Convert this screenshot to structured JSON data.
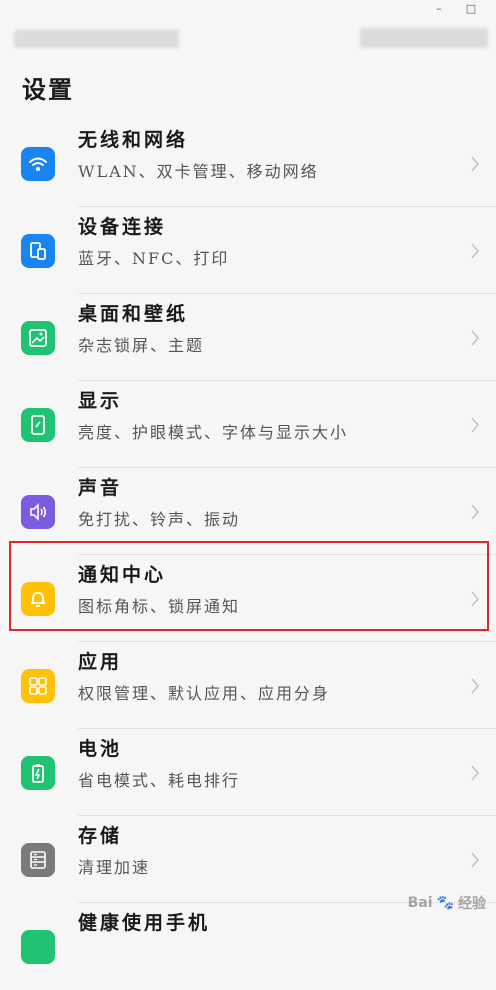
{
  "window_controls": {
    "minimize": "–",
    "maximize": "□"
  },
  "page_title": "设置",
  "settings_items": [
    {
      "label": "无线和网络",
      "sub": "WLAN、双卡管理、移动网络",
      "icon": "wifi-icon",
      "color": "#1a84f0"
    },
    {
      "label": "设备连接",
      "sub": "蓝牙、NFC、打印",
      "icon": "device-connect-icon",
      "color": "#1a84f0"
    },
    {
      "label": "桌面和壁纸",
      "sub": "杂志锁屏、主题",
      "icon": "wallpaper-icon",
      "color": "#1fc372"
    },
    {
      "label": "显示",
      "sub": "亮度、护眼模式、字体与显示大小",
      "icon": "display-icon",
      "color": "#1fc372"
    },
    {
      "label": "声音",
      "sub": "免打扰、铃声、振动",
      "icon": "sound-icon",
      "color": "#7b5be0"
    },
    {
      "label": "通知中心",
      "sub": "图标角标、锁屏通知",
      "icon": "bell-icon",
      "color": "#ffc107"
    },
    {
      "label": "应用",
      "sub": "权限管理、默认应用、应用分身",
      "icon": "apps-icon",
      "color": "#ffc107"
    },
    {
      "label": "电池",
      "sub": "省电模式、耗电排行",
      "icon": "battery-icon",
      "color": "#1fc372"
    },
    {
      "label": "存储",
      "sub": "清理加速",
      "icon": "storage-icon",
      "color": "#7a7a7a"
    },
    {
      "label": "健康使用手机",
      "sub": "",
      "icon": "health-icon",
      "color": "#1fc372"
    }
  ],
  "highlight_color": "#e0262d",
  "watermark": {
    "text": "Bai",
    "suffix": "经验"
  }
}
